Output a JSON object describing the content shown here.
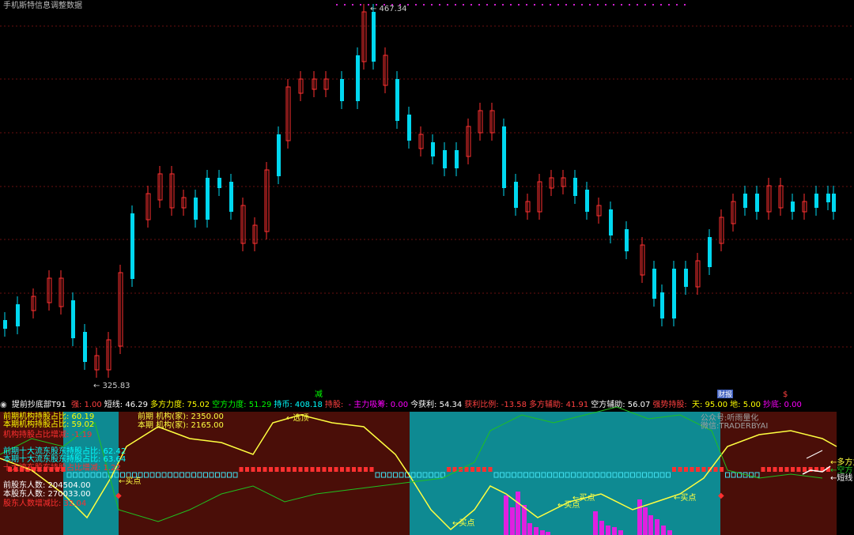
{
  "window_title": "手机斯特信息调整数据",
  "price_high_label": "467.34",
  "price_low_label": "325.83",
  "markers": {
    "jian": "减",
    "caibao": "财报",
    "s": "$"
  },
  "indicator": {
    "name": "提前抄底部T91",
    "items": [
      {
        "k": "强:",
        "v": "1.00",
        "color": "#ff4040"
      },
      {
        "k": "短线:",
        "v": "46.29",
        "color": "#ffffff"
      },
      {
        "k": "多方力度:",
        "v": "75.02",
        "color": "#ffff00"
      },
      {
        "k": "空方力度:",
        "v": "51.29",
        "color": "#00ff00"
      },
      {
        "k": "持币:",
        "v": "408.18",
        "color": "#00ffff"
      },
      {
        "k": "持股:",
        "v": "",
        "color": "#ff4040"
      },
      {
        "k": "- 主力吸筹:",
        "v": "0.00",
        "color": "#ff00ff"
      },
      {
        "k": "今获利:",
        "v": "54.34",
        "color": "#ffffff"
      },
      {
        "k": "获利比例:",
        "v": "-13.58",
        "color": "#ff4040"
      },
      {
        "k": "多方辅助:",
        "v": "41.91",
        "color": "#ff4040"
      },
      {
        "k": "空方辅助:",
        "v": "56.07",
        "color": "#ffffff"
      },
      {
        "k": "强势持股:",
        "v": "",
        "color": "#ff4040"
      },
      {
        "k": "天:",
        "v": "95.00",
        "color": "#ffff00"
      },
      {
        "k": "地:",
        "v": "5.00",
        "color": "#ffff00"
      },
      {
        "k": "抄底:",
        "v": "0.00",
        "color": "#ff00ff"
      }
    ]
  },
  "holdings": [
    {
      "k": "前期机构持股占比:",
      "v": "60.19",
      "color": "#ffff00"
    },
    {
      "k": "本期机构持股占比:",
      "v": "59.02",
      "color": "#ffff00"
    },
    {
      "k": "机构持股占比增减:",
      "v": "-1.19",
      "color": "#ff3030"
    },
    {
      "k": "前期十大流东股东持股占比:",
      "v": "62.42",
      "color": "#00ffff"
    },
    {
      "k": "本期十大流东股东持股占比:",
      "v": "63.64",
      "color": "#00ffff"
    },
    {
      "k": "十大流东股东持股占比增减:",
      "v": "1.22",
      "color": "#ff3030"
    },
    {
      "k": "前股东人数:",
      "v": "204504.00",
      "color": "#ffffff"
    },
    {
      "k": "本股东人数:",
      "v": "270033.00",
      "color": "#ffffff"
    },
    {
      "k": "股东人数增减比:",
      "v": "32.04",
      "color": "#ff3030"
    }
  ],
  "inst": [
    {
      "k": "前期 机构(家):",
      "v": "2350.00"
    },
    {
      "k": "本期 机构(家):",
      "v": "2165.00"
    }
  ],
  "sub_labels": {
    "maidian": "买点",
    "xuanding": "选顶",
    "duofang": "多方力",
    "kongfang": "空方",
    "duanxian": "短线",
    "gzh": "公众号:听雨量化",
    "wx": "微信:TRADERBYAI"
  },
  "colors": {
    "up": "#ff3030",
    "down": "#00d8f0",
    "zone_red": "#4a0e08",
    "zone_teal": "#0e8a92"
  }
}
